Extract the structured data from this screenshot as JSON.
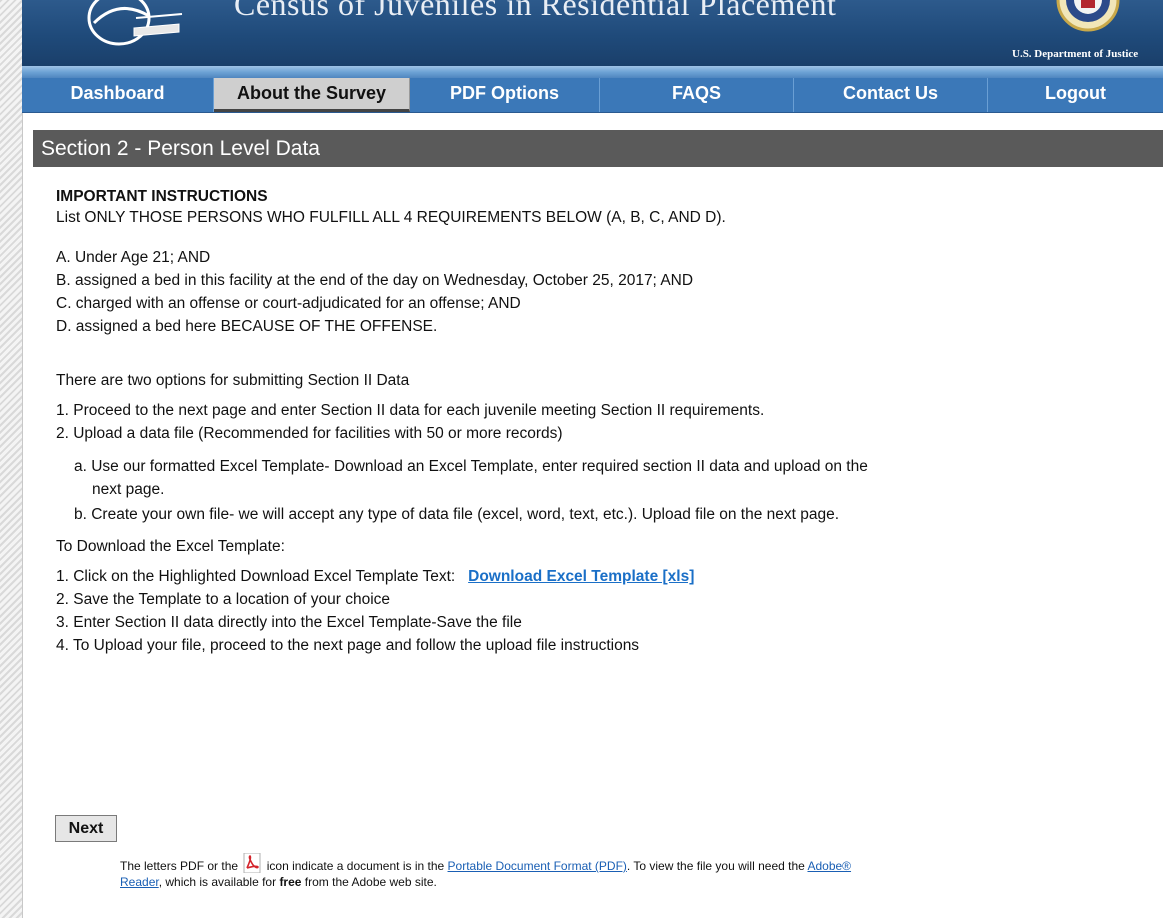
{
  "header": {
    "title": "Census of Juveniles in Residential Placement",
    "department": "U.S. Department of Justice"
  },
  "nav": {
    "items": [
      {
        "label": "Dashboard"
      },
      {
        "label": "About the Survey"
      },
      {
        "label": "PDF Options"
      },
      {
        "label": "FAQS"
      },
      {
        "label": "Contact Us"
      },
      {
        "label": "Logout"
      }
    ]
  },
  "section": {
    "title": "Section 2 - Person Level Data"
  },
  "instructions": {
    "heading": "IMPORTANT INSTRUCTIONS",
    "intro": "List ONLY THOSE PERSONS WHO FULFILL ALL 4 REQUIREMENTS BELOW (A, B, C, AND D).",
    "requirements": [
      "A. Under Age 21; AND",
      "B. assigned a bed in this facility at the end of the day on Wednesday, October 25, 2017; AND",
      "C. charged with an offense or court-adjudicated for an offense; AND",
      "D. assigned a bed here BECAUSE OF THE OFFENSE."
    ],
    "options_intro": "There are two options for submitting Section II Data",
    "options": [
      "1. Proceed to the next page and enter Section II data for each juvenile meeting Section II requirements.",
      "2. Upload a data file (Recommended for facilities with 50 or more records)"
    ],
    "sub_options": [
      "a. Use our formatted Excel Template- Download an Excel Template, enter required section II data and upload on the",
      "next page.",
      "b. Create your own file- we will accept any type of data file (excel, word, text, etc.). Upload file on the next page."
    ],
    "download_intro": "To Download the Excel Template:",
    "download_steps": [
      "1. Click on the Highlighted Download Excel Template Text:",
      "2. Save the Template to a location of your choice",
      "3. Enter Section II data directly into the Excel Template-Save the file",
      "4. To Upload your file, proceed to the next page and follow the upload file instructions"
    ],
    "download_link": "Download Excel Template [xls]"
  },
  "next_label": "Next",
  "footer": {
    "text1": "The letters PDF or the",
    "text2": "icon indicate a document is in the",
    "link_pdf": "Portable Document Format (PDF)",
    "text3": ". To view the file you will need the",
    "link_adobe": "Adobe®",
    "link_reader": "Reader",
    "text4": ", which is available for",
    "free": "free",
    "text5": "from the Adobe web site."
  },
  "colors": {
    "nav_bg": "#3b78b8",
    "header_bg": "#1f4a7a",
    "section_bar": "#5a5a5a",
    "link": "#1a6fc7"
  }
}
